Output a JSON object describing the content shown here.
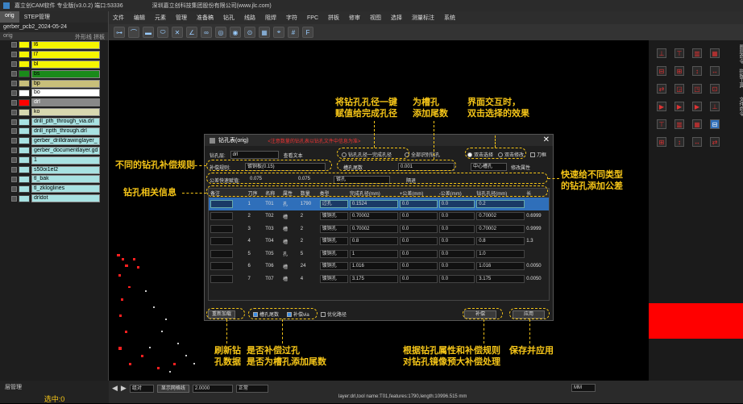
{
  "app": {
    "title": "嘉立创CAM软件 专业版(v3.0.2) 端口:53336",
    "company": "深圳嘉立创科技集团股份有限公司(www.jlc.com)"
  },
  "menu": [
    "文件",
    "编辑",
    "元素",
    "管理",
    "准备稿",
    "钻孔",
    "线路",
    "阻焊",
    "字符",
    "FPC",
    "拼板",
    "修审",
    "视图",
    "选择",
    "测量标注",
    "系统"
  ],
  "left_panel": {
    "tabs": [
      "orig",
      "STEP管理"
    ],
    "job_name": "gerber_pcb2_2024-05-24",
    "col_header": "orig",
    "col_a": "外形线",
    "col_b": "拼板",
    "layers": [
      {
        "name": "l6",
        "color": "#f5f500",
        "bg": "#f5f500"
      },
      {
        "name": "l7",
        "color": "#f5f500",
        "bg": "#f5f500"
      },
      {
        "name": "bl",
        "color": "#f5f500",
        "bg": "#f5f500"
      },
      {
        "name": "bs",
        "color": "#1a8a1a",
        "bg": "#1a8a1a"
      },
      {
        "name": "bp",
        "color": "#c8bf7a",
        "bg": "#c8bf7a"
      },
      {
        "name": "bo",
        "color": "#ffffff",
        "bg": "#ffffff"
      },
      {
        "name": "drl",
        "color": "#ff0000",
        "bg": "#888888"
      },
      {
        "name": "ko",
        "color": "#d8d8b0",
        "bg": "#d8d8b0"
      },
      {
        "name": "drill_pth_through_via.drl",
        "color": "#a8e2e2",
        "bg": "#a8e2e2"
      },
      {
        "name": "drill_npth_through.drl",
        "color": "#a8e2e2",
        "bg": "#a8e2e2"
      },
      {
        "name": "gerber_drilldrawinglayer_",
        "color": "#a8e2e2",
        "bg": "#a8e2e2"
      },
      {
        "name": "gerber_documentlayer.gd",
        "color": "#a8e2e2",
        "bg": "#a8e2e2"
      },
      {
        "name": "1",
        "color": "#a8e2e2",
        "bg": "#a8e2e2"
      },
      {
        "name": "s50oi1el2",
        "color": "#a8e2e2",
        "bg": "#a8e2e2"
      },
      {
        "name": "tl_bak",
        "color": "#a8e2e2",
        "bg": "#a8e2e2"
      },
      {
        "name": "tl_zkloglines",
        "color": "#a8e2e2",
        "bg": "#a8e2e2"
      },
      {
        "name": "drldot",
        "color": "#a8e2e2",
        "bg": "#a8e2e2"
      }
    ],
    "bottom_tab": "层管理",
    "selected": "选中:0"
  },
  "dialog": {
    "title": "钻孔表(orig)",
    "warning": "<注意数量的钻孔表以钻孔文件中信息为准>",
    "layer_label": "钻孔层:",
    "layer_value": "drl",
    "view_text_btn": "查看文本",
    "radio_fill_finish": "钻孔孔径一完成孔径",
    "radio_all_slot": "全部识别钻孔",
    "radio_dbl_sel": "双击选择",
    "radio_dbl_mod": "双击修改",
    "knife_label": "刀框",
    "comp_rule_label": "补偿规则:",
    "comp_rule_value": "镀铜板(0.15)",
    "slot_tail_label": "槽孔尾数",
    "slot_tail_value": "0.001",
    "center_slot": "中心槽孔",
    "edit_attr": "修改属性",
    "tol_label": "公差快速赋值:",
    "tol_plus": "0.075",
    "tol_minus": "0.075",
    "tol_plated": "镀孔",
    "tol_nonplated": "隔退",
    "columns": [
      "备注",
      "刀序",
      "名称",
      "属性",
      "数量",
      "类型",
      "完成孔径(mm)",
      "+公差(mm)",
      "-公差(mm)",
      "钻孔孔径(mm)",
      "长"
    ],
    "rows": [
      {
        "idx": "1",
        "name": "T01",
        "attr": "孔",
        "qty": "1790",
        "type": "过孔",
        "finish": "0.1524",
        "plus": "0.0",
        "minus": "0.0",
        "drill": "0.2",
        "len": ""
      },
      {
        "idx": "2",
        "name": "T02",
        "attr": "槽",
        "qty": "2",
        "type": "镀铜孔",
        "finish": "0.70002",
        "plus": "0.0",
        "minus": "0.0",
        "drill": "0.70002",
        "len": "0.6999"
      },
      {
        "idx": "3",
        "name": "T03",
        "attr": "槽",
        "qty": "2",
        "type": "镀铜孔",
        "finish": "0.70002",
        "plus": "0.0",
        "minus": "0.0",
        "drill": "0.70002",
        "len": "0.9999"
      },
      {
        "idx": "4",
        "name": "T04",
        "attr": "槽",
        "qty": "2",
        "type": "镀铜孔",
        "finish": "0.8",
        "plus": "0.0",
        "minus": "0.0",
        "drill": "0.8",
        "len": "1.3"
      },
      {
        "idx": "5",
        "name": "T05",
        "attr": "孔",
        "qty": "5",
        "type": "镀铜孔",
        "finish": "1",
        "plus": "0.0",
        "minus": "0.0",
        "drill": "1.0",
        "len": ""
      },
      {
        "idx": "6",
        "name": "T06",
        "attr": "槽",
        "qty": "24",
        "type": "镀铜孔",
        "finish": "1.016",
        "plus": "0.0",
        "minus": "0.0",
        "drill": "1.016",
        "len": "0.0050"
      },
      {
        "idx": "7",
        "name": "T07",
        "attr": "槽",
        "qty": "4",
        "type": "镀铜孔",
        "finish": "3.175",
        "plus": "0.0",
        "minus": "0.0",
        "drill": "3.175",
        "len": "0.0050"
      }
    ],
    "btn_refresh": "重新加载",
    "chk_slot_tail": "槽孔尾数",
    "chk_comp": "补偿via",
    "btn_optimize": "优化路径",
    "btn_comp": "补偿",
    "btn_apply": "应用"
  },
  "annotations": {
    "a1": "将钻孔孔径一键\n赋值给完成孔径",
    "a2": "为槽孔\n添加尾数",
    "a3": "界面交互时，\n双击选择的效果",
    "a4": "不同的钻孔补偿规则",
    "a5": "快速给不同类型\n的钻孔添加公差",
    "a6": "钻孔相关信息",
    "a7": "刷新钻\n孔数据",
    "a8": "是否补偿过孔\n是否为槽孔添加尾数",
    "a9": "根据钻孔属性和补偿规则\n对钻孔镜像预大补偿处理",
    "a10": "保存并应用"
  },
  "status": {
    "mode": "组对",
    "coord_label": "显示网格线",
    "value": "2.0000",
    "line_mode": "正常",
    "info": "layer:drl,tool name:T01,features:1790,length:10996.515 mm",
    "unit": "MM"
  },
  "right_panel": {
    "tab_a": "图层命令",
    "tab_b": "拼板工具",
    "tab_c": "文件命令"
  }
}
